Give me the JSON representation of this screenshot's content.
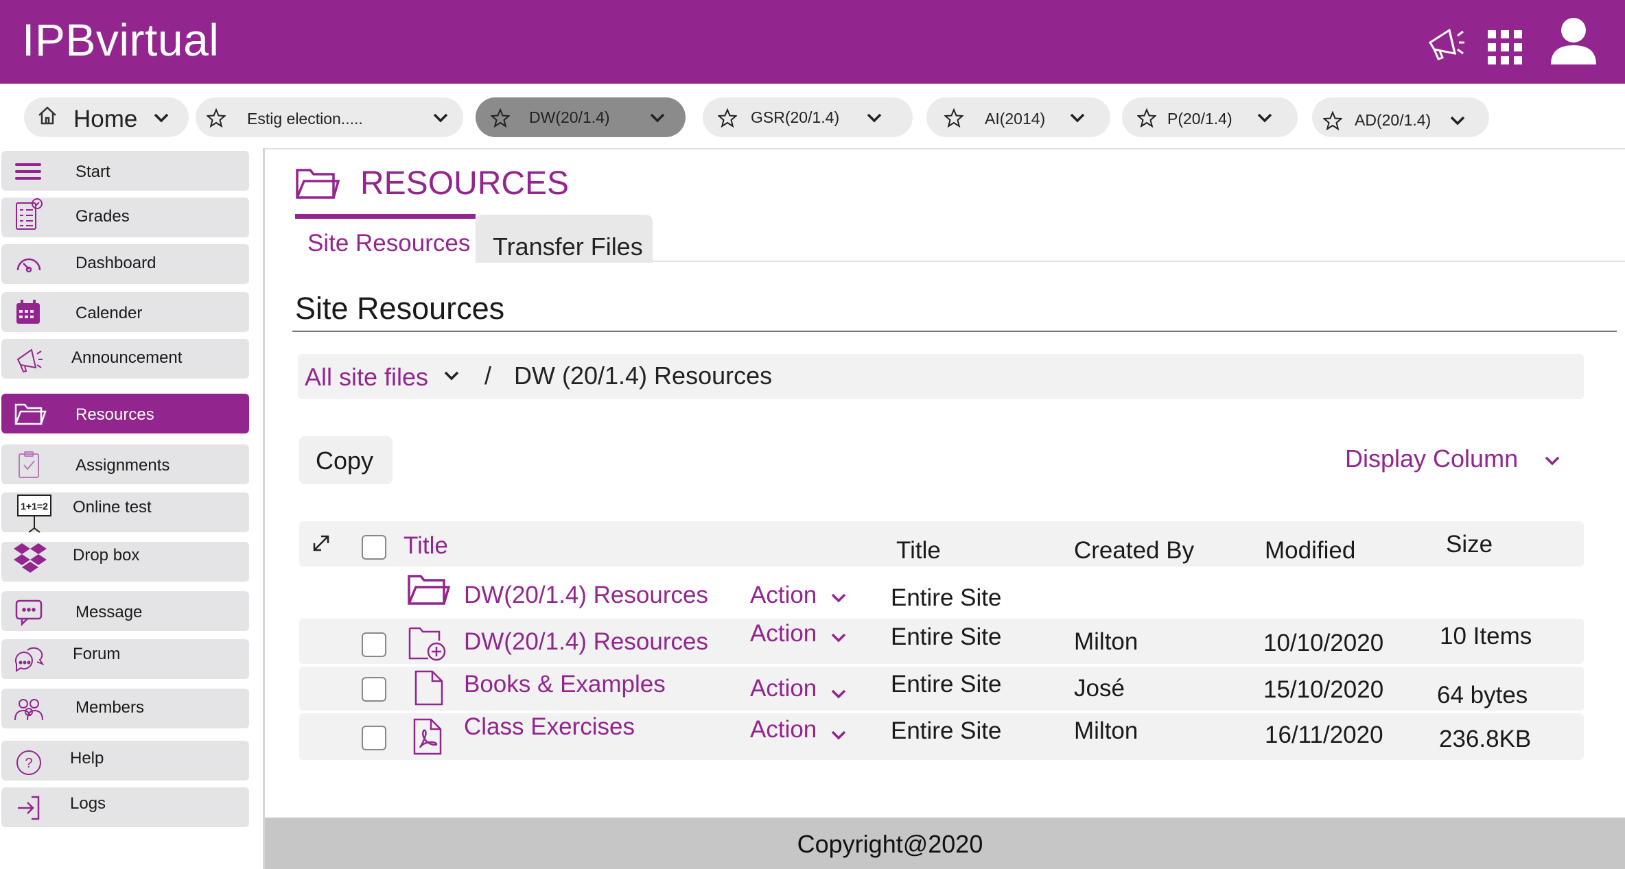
{
  "app": {
    "title": "IPBvirtual"
  },
  "header_icons": [
    "megaphone-icon",
    "apps-grid-icon",
    "user-icon"
  ],
  "course_tabs": [
    {
      "label": "Home",
      "icon": "home-icon",
      "active": false
    },
    {
      "label": "Estig election.....",
      "icon": "star-icon",
      "active": false
    },
    {
      "label": "DW(20/1.4)",
      "icon": "star-icon",
      "active": true
    },
    {
      "label": "GSR(20/1.4)",
      "icon": "star-icon",
      "active": false
    },
    {
      "label": "AI(2014)",
      "icon": "star-icon",
      "active": false
    },
    {
      "label": "P(20/1.4)",
      "icon": "star-icon",
      "active": false
    },
    {
      "label": "AD(20/1.4)",
      "icon": "star-icon",
      "active": false
    }
  ],
  "sidebar": {
    "items": [
      {
        "label": "Start",
        "icon": "menu-icon"
      },
      {
        "label": "Grades",
        "icon": "grades-icon"
      },
      {
        "label": "Dashboard",
        "icon": "dashboard-icon"
      },
      {
        "label": "Calender",
        "icon": "calendar-icon"
      },
      {
        "label": "Announcement",
        "icon": "megaphone-icon"
      },
      {
        "label": "Resources",
        "icon": "folder-icon",
        "active": true
      },
      {
        "label": "Assignments",
        "icon": "assignment-icon"
      },
      {
        "label": "Online test",
        "icon": "online-test-icon"
      },
      {
        "label": "Drop box",
        "icon": "dropbox-icon"
      },
      {
        "label": "Message",
        "icon": "message-icon"
      },
      {
        "label": "Forum",
        "icon": "forum-icon"
      },
      {
        "label": "Members",
        "icon": "members-icon"
      },
      {
        "label": "Help",
        "icon": "help-icon"
      },
      {
        "label": "Logs",
        "icon": "logs-icon"
      }
    ]
  },
  "page": {
    "heading": "RESOURCES",
    "tabs": [
      "Site Resources",
      "Transfer Files"
    ],
    "section_title": "Site Resources",
    "breadcrumb": {
      "root": "All site files",
      "separator": "/",
      "current": "DW (20/1.4) Resources"
    },
    "copy_label": "Copy",
    "display_column_label": "Display Column"
  },
  "table": {
    "headers": {
      "title_sort": "Title",
      "title": "Title",
      "created_by": "Created By",
      "modified": "Modified",
      "size": "Size"
    },
    "rows": [
      {
        "name": "DW(20/1.4) Resources",
        "icon": "folder-open-icon",
        "action": "Action",
        "access": "Entire Site",
        "created_by": "",
        "modified": "",
        "size": "",
        "has_checkbox": false
      },
      {
        "name": "DW(20/1.4) Resources",
        "icon": "folder-add-icon",
        "action": "Action",
        "access": "Entire Site",
        "created_by": "Milton",
        "modified": "10/10/2020",
        "size": "10 Items",
        "has_checkbox": true
      },
      {
        "name": "Books & Examples",
        "icon": "document-icon",
        "action": "Action",
        "access": "Entire Site",
        "created_by": "José",
        "modified": "15/10/2020",
        "size": "64 bytes",
        "has_checkbox": true
      },
      {
        "name": "Class Exercises",
        "icon": "pdf-icon",
        "action": "Action",
        "access": "Entire Site",
        "created_by": "Milton",
        "modified": "16/11/2020",
        "size": "236.8KB",
        "has_checkbox": true
      }
    ]
  },
  "footer": {
    "text": "Copyright@2020"
  },
  "colors": {
    "brand": "#93258f",
    "active_tab": "#8b8b8b",
    "sidebar_item": "#e4e4e6",
    "footer": "#c6c6c6"
  }
}
